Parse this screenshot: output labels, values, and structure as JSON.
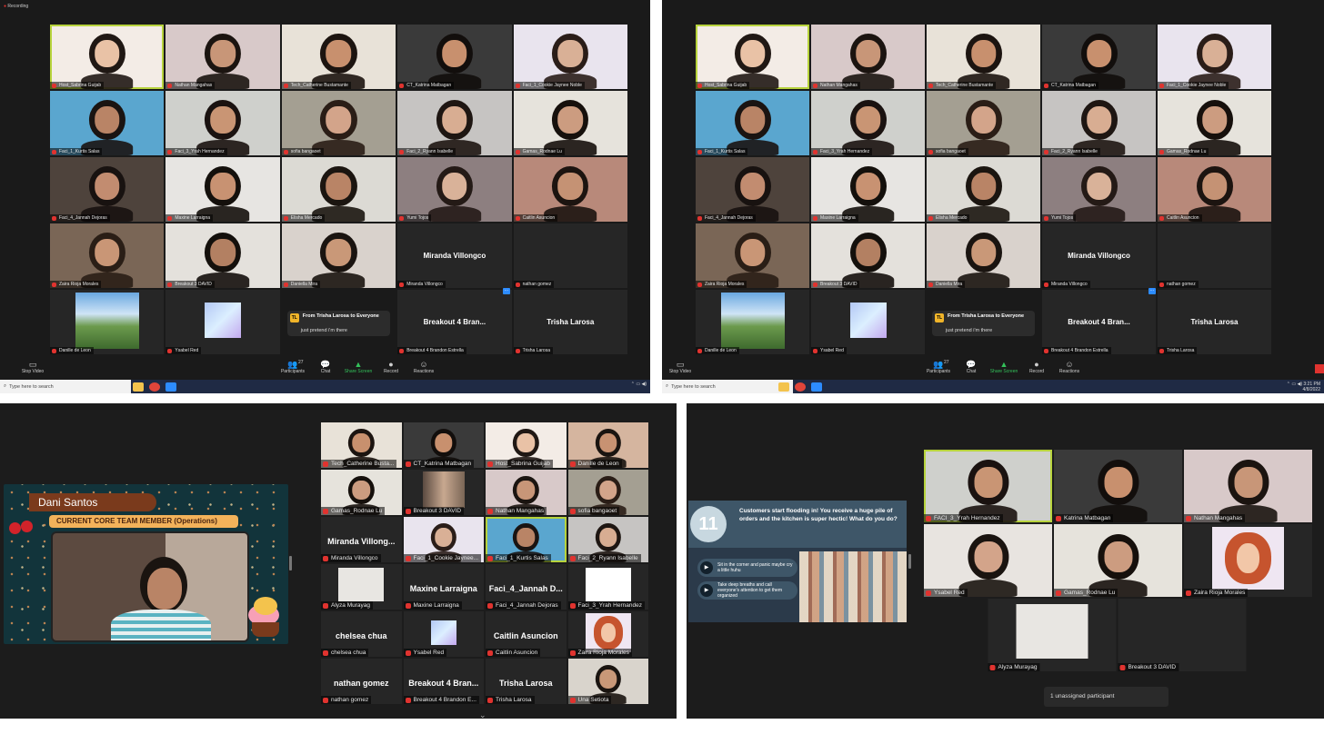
{
  "colors": {
    "zoom_bg": "#1a1a1a",
    "tile_bg": "#262626",
    "active_speaker": "#b7d33c",
    "mic_muted": "#e0332f",
    "taskbar": "#1f2a44",
    "zoom_blue": "#2d8cff",
    "share_green": "#33c15a"
  },
  "top_left": {
    "recording_label": "Recording",
    "rows": [
      [
        {
          "name": "Host_Sabrina Guijab",
          "hl": true,
          "bg": "#f3ece6",
          "skin": "#e9c2a6",
          "hair": "#201814"
        },
        {
          "name": "Nathan Mangahas",
          "bg": "#d8c9c9",
          "skin": "#c89678",
          "hair": "#1b1410"
        },
        {
          "name": "Tech_Catherine Bustamante",
          "bg": "#e8e2d8",
          "skin": "#c8906e",
          "hair": "#1c1410"
        },
        {
          "name": "CT_Katrina Matbagan",
          "bg": "#3a3a3a",
          "skin": "#c8906e",
          "hair": "#120e0c"
        },
        {
          "name": "Faci_1_Cookie Jaynee Noble",
          "bg": "#e9e4ee",
          "skin": "#d9b096",
          "hair": "#2a1d18"
        }
      ],
      [
        {
          "name": "Faci_1_Kurtis Salas",
          "bg": "#5aa6cf",
          "skin": "#b98466",
          "hair": "#1a1412"
        },
        {
          "name": "Faci_3_Yrah Hernandez",
          "bg": "#cfd0cc",
          "skin": "#c99574",
          "hair": "#1a1210"
        },
        {
          "name": "sofia bangaoet",
          "bg": "#a49f92",
          "skin": "#d3a48a",
          "hair": "#2a1d16"
        },
        {
          "name": "Faci_2_Ryann Isabelle",
          "bg": "#c6c4c2",
          "skin": "#d8ad92",
          "hair": "#1e1612"
        },
        {
          "name": "Gamas_Rodnae Lu",
          "bg": "#e6e3dc",
          "skin": "#cc9c80",
          "hair": "#16100c"
        }
      ],
      [
        {
          "name": "Faci_4_Jannah Dejoras",
          "bg": "#4e433c",
          "skin": "#c28c70",
          "hair": "#181210"
        },
        {
          "name": "Maxine Larraigna",
          "bg": "#e7e5e2",
          "skin": "#c89272",
          "hair": "#14100c"
        },
        {
          "name": "Elisha Mercado",
          "bg": "#dcdad4",
          "skin": "#b98466",
          "hair": "#1b1510"
        },
        {
          "name": "Yumi Tojos",
          "bg": "#8d7f80",
          "skin": "#d9b299",
          "hair": "#241a16"
        },
        {
          "name": "Caitlin Asuncion",
          "bg": "#b8897a",
          "skin": "#c59274",
          "hair": "#1c1410"
        }
      ],
      [
        {
          "name": "Zaira Rioja Morales",
          "bg": "#7a6656",
          "skin": "#c99676",
          "hair": "#2a1e16"
        },
        {
          "name": "Breakout 3 DAVID",
          "bg": "#e4e1dc",
          "skin": "#b38062",
          "hair": "#14100c"
        },
        {
          "name": "Daniella Mira",
          "bg": "#d9d2cc",
          "skin": "#c99878",
          "hair": "#1a1410"
        },
        {
          "name": "Miranda Villongco",
          "big": "Miranda Villongco"
        },
        {
          "name": "nathan gomez",
          "big": ""
        }
      ],
      [
        {
          "name": "Danille de Leon",
          "bg": "#6c9a4d",
          "sky": true
        },
        {
          "name": "Ysabel Red",
          "gradient": true
        },
        {
          "name": "",
          "chat": true
        },
        {
          "name": "Breakout 4 Brandon Estrella",
          "big": "Breakout 4 Bran..."
        },
        {
          "name": "Trisha Larosa",
          "big": "Trisha Larosa"
        }
      ]
    ],
    "toolbar": [
      {
        "label": "Participants",
        "icon": "👥",
        "count": "27"
      },
      {
        "label": "Chat",
        "icon": "💬"
      },
      {
        "label": "Share Screen",
        "icon": "▲",
        "green": true
      },
      {
        "label": "Record",
        "icon": "●"
      },
      {
        "label": "Reactions",
        "icon": "☺"
      }
    ],
    "left_button": "Stop Video"
  },
  "chat_popup": {
    "badge": "TL",
    "from": "From Trisha Larosa to Everyone",
    "message": "just pretend i'm there"
  },
  "taskbar": {
    "search_placeholder": "Type here to search",
    "time": "3:21 PM",
    "date": "4/8/2022"
  },
  "bottom_left": {
    "presenter_name": "Dani Santos",
    "presenter_role": "CURRENT CORE TEAM MEMBER (Operations)",
    "rows": [
      [
        {
          "name": "Tech_Catherine Busta...",
          "bg": "#e8e2d8",
          "skin": "#c8906e",
          "hair": "#1c1410"
        },
        {
          "name": "CT_Katrina Matbagan",
          "bg": "#3a3a3a",
          "skin": "#c8906e",
          "hair": "#120e0c"
        },
        {
          "name": "Host_Sabrina Guijab",
          "bg": "#f3ece6",
          "skin": "#e9c2a6",
          "hair": "#201814"
        },
        {
          "name": "Danille de Leon",
          "bg": "#d5b59f",
          "skin": "#c89272",
          "hair": "#1a1410"
        }
      ],
      [
        {
          "name": "Gamas_Rodnae Lu",
          "bg": "#e6e3dc",
          "skin": "#cc9c80",
          "hair": "#16100c"
        },
        {
          "name": "Breakout 3 DAVID",
          "bg": "#8a7a6e",
          "blur": true
        },
        {
          "name": "Nathan Mangahas",
          "bg": "#d8c9c9",
          "skin": "#c89678",
          "hair": "#1b1410"
        },
        {
          "name": "sofia bangaoet",
          "bg": "#a49f92",
          "skin": "#d3a48a",
          "hair": "#2a1d16"
        }
      ],
      [
        {
          "name": "Miranda Villongco",
          "big": "Miranda Villong..."
        },
        {
          "name": "Faci_1_Cookie Jaynee...",
          "bg": "#e9e4ee",
          "skin": "#d9b096",
          "hair": "#2a1d18"
        },
        {
          "name": "Faci_1_Kurtis Salas",
          "bg": "#5aa6cf",
          "skin": "#b98466",
          "hair": "#1a1412",
          "hl": true
        },
        {
          "name": "Faci_2_Ryann Isabelle",
          "bg": "#c6c4c2",
          "skin": "#d8ad92",
          "hair": "#1e1612"
        }
      ],
      [
        {
          "name": "Alyza Murayag",
          "plain": "#e8e6e2"
        },
        {
          "name": "Maxine Larraigna",
          "big": "Maxine Larraigna"
        },
        {
          "name": "Faci_4_Jannah Dejoras",
          "big": "Faci_4_Jannah D..."
        },
        {
          "name": "Faci_3_Yrah Hernandez",
          "plain": "#ffffff"
        }
      ],
      [
        {
          "name": "chelsea chua",
          "big": "chelsea chua"
        },
        {
          "name": "Ysabel Red",
          "gradient": true
        },
        {
          "name": "Caitlin Asuncion",
          "big": "Caitlin Asuncion"
        },
        {
          "name": "Zaira Rioja Morales",
          "cartoon": true
        }
      ],
      [
        {
          "name": "nathan gomez",
          "big": "nathan gomez"
        },
        {
          "name": "Breakout 4 Brandon E...",
          "big": "Breakout 4 Bran..."
        },
        {
          "name": "Trisha Larosa",
          "big": "Trisha Larosa"
        },
        {
          "name": "Una Setiota",
          "bg": "#d9d4cc",
          "skin": "#c99878",
          "hair": "#1a1410"
        }
      ]
    ]
  },
  "bottom_right": {
    "slide_number": "11",
    "slide_question": "Customers start flooding in! You receive a huge pile of orders and the kitchen is super hectic! What do you do?",
    "slide_options": [
      "Sit in the corner and panic maybe cry a little huhu",
      "Take deep breaths and call everyone's attention to get them organized"
    ],
    "rows": [
      [
        {
          "name": "FACI_3_Yrah Hernandez",
          "hl": true,
          "bg": "#cfd0cc",
          "skin": "#c99574",
          "hair": "#1a1210"
        },
        {
          "name": "Katrina Matbagan",
          "bg": "#3a3a3a",
          "skin": "#c8906e",
          "hair": "#120e0c"
        },
        {
          "name": "Nathan Mangahas",
          "bg": "#d8c9c9",
          "skin": "#c89678",
          "hair": "#1b1410"
        }
      ],
      [
        {
          "name": "Ysabel Red",
          "bg": "#e8e4e0",
          "skin": "#d3a48a",
          "hair": "#1a1410"
        },
        {
          "name": "Gamas_Rodnae Lu",
          "bg": "#e6e3dc",
          "skin": "#cc9c80",
          "hair": "#16100c"
        },
        {
          "name": "Zaira Rioja Morales",
          "cartoon": true
        }
      ],
      [
        {
          "name": "Alyza Murayag",
          "plain": "#e8e6e2"
        },
        {
          "name": "Breakout 3 DAVID",
          "big": ""
        }
      ]
    ],
    "unassigned": "1 unassigned participant"
  }
}
